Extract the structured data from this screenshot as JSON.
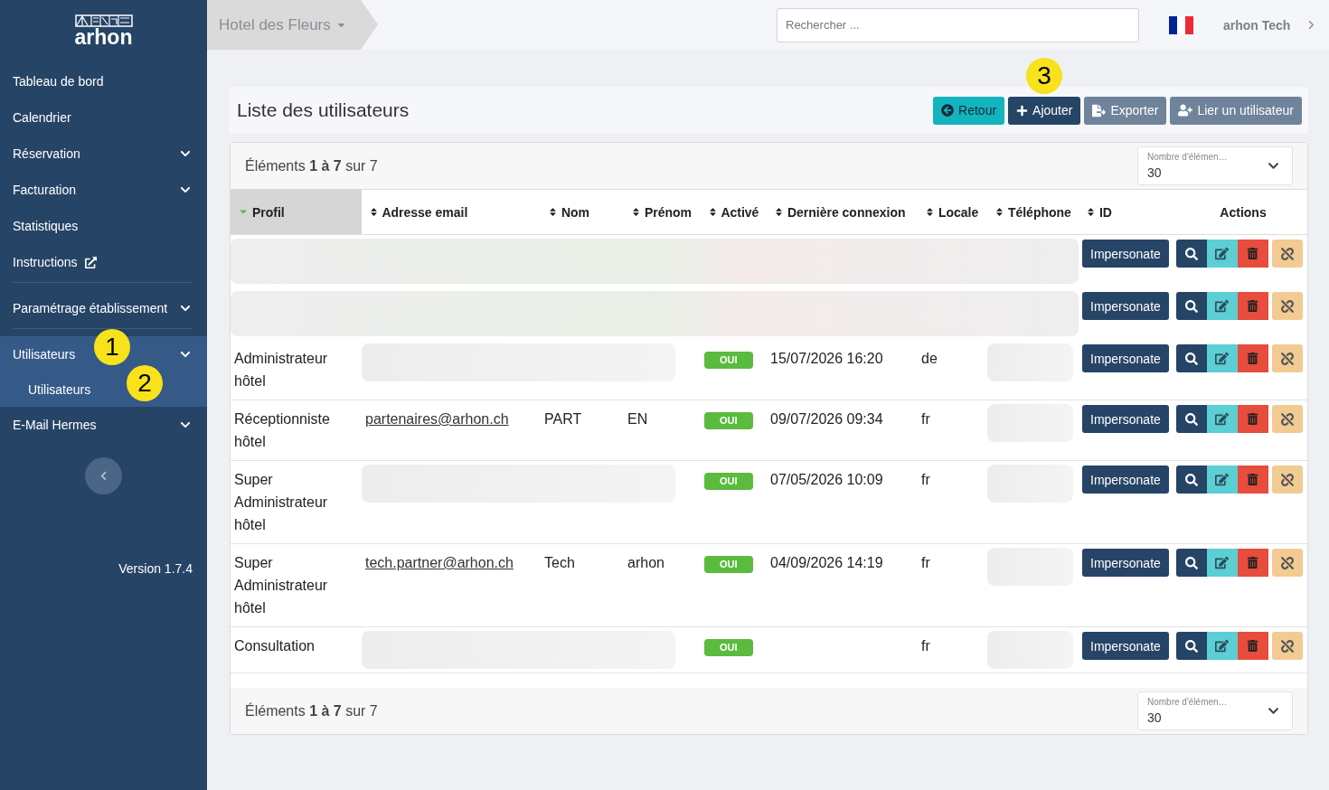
{
  "sidebar": {
    "logo": "arhon",
    "items": [
      {
        "label": "Tableau de bord",
        "kind": "link",
        "selected": false
      },
      {
        "label": "Calendrier",
        "kind": "link",
        "selected": false
      },
      {
        "label": "Réservation",
        "kind": "group",
        "selected": false
      },
      {
        "label": "Facturation",
        "kind": "group",
        "selected": false
      },
      {
        "label": "Statistiques",
        "kind": "link",
        "selected": false
      },
      {
        "label": "Instructions",
        "kind": "external",
        "selected": false
      },
      {
        "kind": "divider"
      },
      {
        "label": "Paramétrage établissement",
        "kind": "group",
        "selected": false
      },
      {
        "kind": "divider"
      },
      {
        "label": "Utilisateurs",
        "kind": "group",
        "selected": true,
        "annotation": "1",
        "children": [
          {
            "label": "Utilisateurs",
            "selected": true,
            "annotation": "2"
          }
        ]
      },
      {
        "label": "E-Mail Hermes",
        "kind": "group",
        "selected": false
      }
    ],
    "version": "Version 1.7.4"
  },
  "topbar": {
    "breadcrumb": "Hotel des Fleurs",
    "search": {
      "placeholder": "Rechercher ..."
    },
    "user": "arhon Tech"
  },
  "page": {
    "title": "Liste des utilisateurs",
    "buttons": [
      {
        "label": "Retour",
        "kind": "back"
      },
      {
        "label": "Ajouter",
        "kind": "add",
        "annotation": "3"
      },
      {
        "label": "Exporter",
        "kind": "export"
      },
      {
        "label": "Lier un utilisateur",
        "kind": "link"
      }
    ]
  },
  "table": {
    "summary_top": "Éléments **1 à 7** sur 7",
    "summary_bottom": "Éléments **1 à 7** sur 7",
    "page_size_top": {
      "label": "Nombre d'élémen…",
      "value": "30"
    },
    "page_size_bottom": {
      "label": "Nombre d'élémen…",
      "value": "30"
    },
    "columns": [
      {
        "label": "Profil",
        "kind": "sortable",
        "sorted": true
      },
      {
        "label": "Adresse email",
        "kind": "sortable",
        "sorted": false
      },
      {
        "label": "Nom",
        "kind": "sortable",
        "sorted": false
      },
      {
        "label": "Prénom",
        "kind": "sortable",
        "sorted": false
      },
      {
        "label": "Activé",
        "kind": "sortable",
        "sorted": false
      },
      {
        "label": "Dernière connexion",
        "kind": "sortable",
        "sorted": false
      },
      {
        "label": "Locale",
        "kind": "sortable",
        "sorted": false
      },
      {
        "label": "Téléphone",
        "kind": "sortable",
        "sorted": false
      },
      {
        "label": "ID",
        "kind": "sortable",
        "sorted": false
      },
      {
        "label": "Actions",
        "kind": "plain"
      }
    ],
    "rows": [
      {
        "kind": "redacted",
        "impersonate": "Impersonate"
      },
      {
        "kind": "redacted",
        "impersonate": "Impersonate"
      },
      {
        "kind": "user",
        "profile": "Administrateur hôtel",
        "active": "OUI",
        "last_login": "15/07/2026 16:20",
        "locale": "de",
        "impersonate": "Impersonate"
      },
      {
        "kind": "user",
        "profile": "Réceptionniste hôtel",
        "email": "partenaires@arhon.ch",
        "last_name": "PART",
        "first_name": "EN",
        "active": "OUI",
        "last_login": "09/07/2026 09:34",
        "locale": "fr",
        "impersonate": "Impersonate"
      },
      {
        "kind": "user",
        "profile": "Super Administrateur hôtel",
        "active": "OUI",
        "last_login": "07/05/2026 10:09",
        "locale": "fr",
        "impersonate": "Impersonate"
      },
      {
        "kind": "user",
        "profile": "Super Administrateur hôtel",
        "email": "tech.partner@arhon.ch",
        "last_name": "Tech",
        "first_name": "arhon",
        "active": "OUI",
        "last_login": "04/09/2026 14:19",
        "locale": "fr",
        "impersonate": "Impersonate"
      },
      {
        "kind": "user",
        "profile": "Consultation",
        "active": "OUI",
        "locale": "fr",
        "impersonate": "Impersonate"
      }
    ]
  }
}
